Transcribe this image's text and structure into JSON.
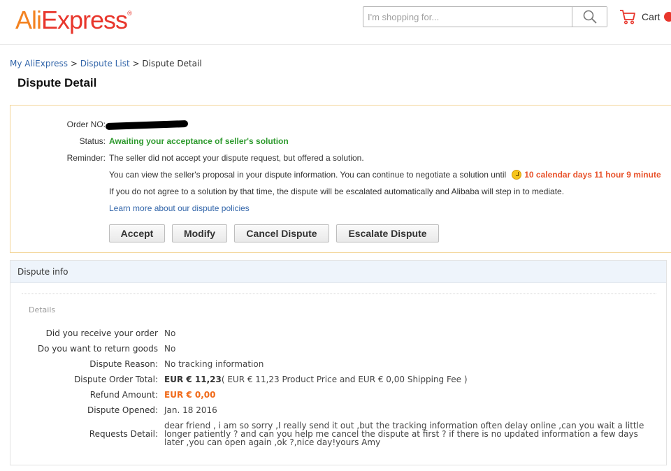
{
  "header": {
    "logo_part1": "Ali",
    "logo_part2": "Express",
    "logo_tm": "®",
    "search_placeholder": "I'm shopping for...",
    "search_icon": "search-icon",
    "cart_icon": "cart-icon",
    "cart_label": "Cart"
  },
  "breadcrumb": {
    "items": [
      "My AliExpress",
      "Dispute List",
      "Dispute Detail"
    ],
    "separator": ">"
  },
  "page_title": "Dispute Detail",
  "status_box": {
    "order_no_label": "Order NO:",
    "status_label": "Status:",
    "status_value": "Awaiting your acceptance of seller's solution",
    "reminder_label": "Reminder:",
    "reminder_line1": "The seller did not accept your dispute request, but offered a solution.",
    "reminder_line2": "You can view the seller's proposal in your dispute information. You can continue to negotiate a solution until",
    "deadline": "10 calendar days 11 hour 9 minute",
    "reminder_line3": "If you do not agree to a solution by that time, the dispute will be escalated automatically and Alibaba will step in to mediate.",
    "policy_link": "Learn more about our dispute policies",
    "buttons": {
      "accept": "Accept",
      "modify": "Modify",
      "cancel": "Cancel Dispute",
      "escalate": "Escalate Dispute"
    }
  },
  "dispute_info": {
    "header": "Dispute info",
    "details_label": "Details",
    "rows": [
      {
        "label": "Did you receive your order",
        "value": "No"
      },
      {
        "label": "Do you want to return goods",
        "value": "No"
      },
      {
        "label": "Dispute Reason:",
        "value": "No tracking information"
      },
      {
        "label": "Dispute Order Total:",
        "value_bold": "EUR € 11,23",
        "value_rest": "( EUR € 11,23 Product Price and EUR € 0,00 Shipping Fee )"
      },
      {
        "label": "Refund Amount:",
        "value": "EUR € 0,00"
      },
      {
        "label": "Dispute Opened:",
        "value": "Jan. 18 2016"
      },
      {
        "label": "Requests Detail:",
        "value": "dear friend , i am so sorry ,I really send it out ,but the tracking information often delay online ,can you wait a little longer patiently ? and can you help me cancel the dispute at first ? if there is no updated information a few days later ,you can open again ,ok ?,nice day!yours Amy"
      }
    ]
  },
  "colors": {
    "status_green": "#2e9a2e",
    "deadline_orange": "#e8532c",
    "refund_orange": "#f06a19",
    "link_blue": "#3366aa"
  }
}
